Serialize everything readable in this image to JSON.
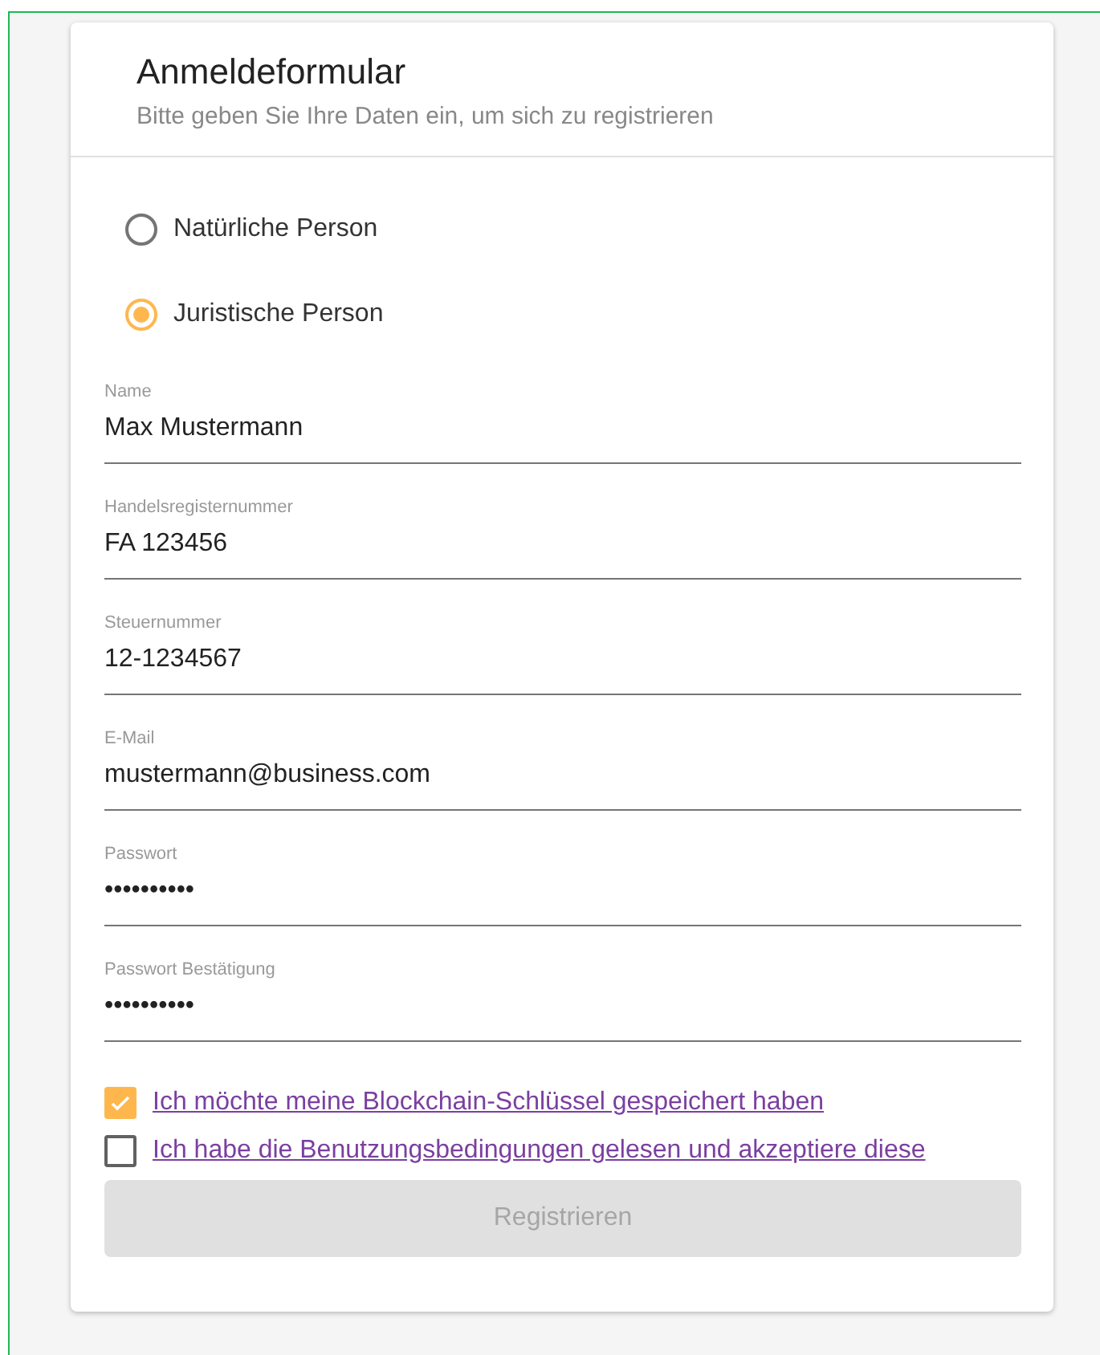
{
  "header": {
    "title": "Anmeldeformular",
    "subtitle": "Bitte geben Sie Ihre Daten ein, um sich zu registrieren"
  },
  "person_type": [
    {
      "label": "Natürliche Person",
      "selected": false
    },
    {
      "label": "Juristische Person",
      "selected": true
    }
  ],
  "fields": [
    {
      "label": "Name",
      "value": "Max Mustermann"
    },
    {
      "label": "Handelsregisternummer",
      "value": "FA 123456"
    },
    {
      "label": "Steuernummer",
      "value": "12-1234567"
    },
    {
      "label": "E-Mail",
      "value": "mustermann@business.com"
    },
    {
      "label": "Passwort",
      "value": "••••••••••"
    },
    {
      "label": "Passwort Bestätigung",
      "value": "••••••••••"
    }
  ],
  "checkboxes": [
    {
      "label": "Ich möchte meine Blockchain-Schlüssel gespeichert haben",
      "checked": true
    },
    {
      "label": "Ich habe die Benutzungsbedingungen gelesen und akzeptiere diese",
      "checked": false
    }
  ],
  "submit": {
    "label": "Registrieren",
    "disabled": true
  }
}
